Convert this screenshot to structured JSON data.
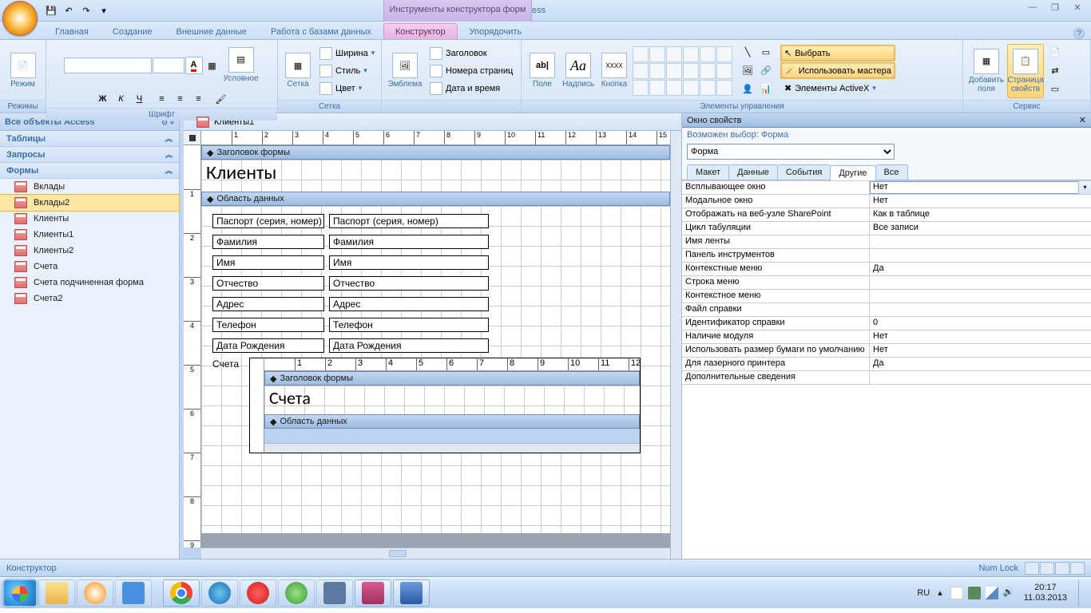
{
  "title": {
    "app": "Microsoft Access",
    "context": "Инструменты конструктора форм"
  },
  "win": {
    "min": "—",
    "max": "❐",
    "close": "✕"
  },
  "qat": {
    "save": "💾",
    "undo": "↶",
    "redo": "↷",
    "more": "▾"
  },
  "tabs": {
    "home": "Главная",
    "create": "Создание",
    "external": "Внешние данные",
    "dbTools": "Работа с базами данных",
    "design": "Конструктор",
    "arrange": "Упорядочить",
    "help": "?"
  },
  "ribbon": {
    "g1": {
      "view": "Режим",
      "label": "Режимы"
    },
    "g2": {
      "bold": "Ж",
      "italic": "К",
      "underline": "Ч",
      "cond": "Условное",
      "label": "Шрифт"
    },
    "g3": {
      "grid": "Сетка",
      "width": "Ширина",
      "style": "Стиль",
      "color": "Цвет",
      "label": "Сетка"
    },
    "g4": {
      "logo": "Эмблема",
      "title": "Заголовок",
      "pagenum": "Номера страниц",
      "datetime": "Дата и время"
    },
    "g5": {
      "field": "Поле",
      "labelc": "Надпись",
      "button": "Кнопка",
      "select": "Выбрать",
      "wizards": "Использовать мастера",
      "activex": "Элементы ActiveX",
      "label": "Элементы управления"
    },
    "g6": {
      "addfields": "Добавить поля",
      "propsheet": "Страница свойств",
      "label": "Сервис"
    }
  },
  "nav": {
    "header": "Все объекты Access",
    "sections": {
      "tables": "Таблицы",
      "queries": "Запросы",
      "forms": "Формы"
    },
    "forms": [
      "Вклады",
      "Вклады2",
      "Клиенты",
      "Клиенты1",
      "Клиенты2",
      "Счета",
      "Счета подчиненная форма",
      "Счета2"
    ],
    "selectedIndex": 1,
    "chev_dd": "«",
    "chev_up": "︽",
    "chev_dn": "▾"
  },
  "doc": {
    "tab": "Клиенты1",
    "sec_header": "Заголовок формы",
    "sec_detail": "Область данных",
    "title": "Клиенты",
    "fields": [
      {
        "label": "Паспорт (серия, номер)",
        "value": "Паспорт (серия, номер)"
      },
      {
        "label": "Фамилия",
        "value": "Фамилия"
      },
      {
        "label": "Имя",
        "value": "Имя"
      },
      {
        "label": "Отчество",
        "value": "Отчество"
      },
      {
        "label": "Адрес",
        "value": "Адрес"
      },
      {
        "label": "Телефон",
        "value": "Телефон"
      },
      {
        "label": "Дата Рождения",
        "value": "Дата Рождения"
      }
    ],
    "subform_label": "Счета",
    "sub_sec_header": "Заголовок формы",
    "sub_title": "Счета",
    "sub_sec_detail": "Область данных"
  },
  "props": {
    "title": "Окно свойств",
    "subtitle": "Возможен выбор:  Форма",
    "selector": "Форма",
    "tabs": {
      "format": "Макет",
      "data": "Данные",
      "event": "События",
      "other": "Другие",
      "all": "Все"
    },
    "activeTab": "other",
    "rows": [
      {
        "k": "Всплывающее окно",
        "v": "Нет"
      },
      {
        "k": "Модальное окно",
        "v": "Нет"
      },
      {
        "k": "Отображать на веб-узле SharePoint",
        "v": "Как в таблице"
      },
      {
        "k": "Цикл табуляции",
        "v": "Все записи"
      },
      {
        "k": "Имя ленты",
        "v": ""
      },
      {
        "k": "Панель инструментов",
        "v": ""
      },
      {
        "k": "Контекстные меню",
        "v": "Да"
      },
      {
        "k": "Строка меню",
        "v": ""
      },
      {
        "k": "Контекстное меню",
        "v": ""
      },
      {
        "k": "Файл справки",
        "v": ""
      },
      {
        "k": "Идентификатор справки",
        "v": "0"
      },
      {
        "k": "Наличие модуля",
        "v": "Нет"
      },
      {
        "k": "Использовать размер бумаги по умолчанию",
        "v": "Нет"
      },
      {
        "k": "Для лазерного принтера",
        "v": "Да"
      },
      {
        "k": "Дополнительные сведения",
        "v": ""
      }
    ],
    "close": "✕"
  },
  "status": {
    "left": "Конструктор",
    "numlock": "Num Lock"
  },
  "tray": {
    "lang": "RU",
    "up": "▴",
    "time": "20:17",
    "date": "11.03.2013"
  }
}
